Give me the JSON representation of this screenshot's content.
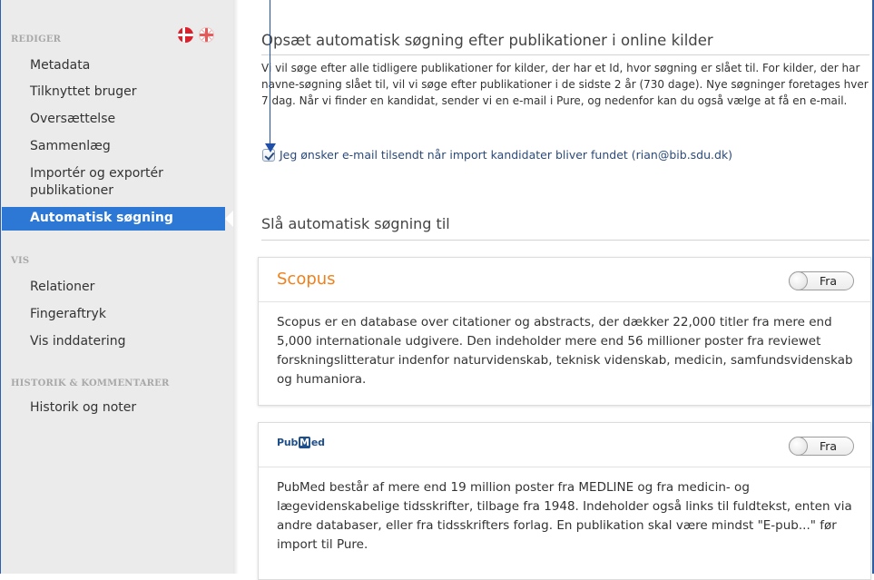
{
  "sidebar": {
    "section_edit": "REDIGER",
    "edit_items": [
      {
        "label": "Metadata"
      },
      {
        "label": "Tilknyttet bruger"
      },
      {
        "label": "Oversættelse"
      },
      {
        "label": "Sammenlæg"
      },
      {
        "label": "Importér og exportér publikationer"
      },
      {
        "label": "Automatisk søgning",
        "active": true
      }
    ],
    "section_view": "VIS",
    "view_items": [
      {
        "label": "Relationer"
      },
      {
        "label": "Fingeraftryk"
      },
      {
        "label": "Vis inddatering"
      }
    ],
    "section_history": "HISTORIK & KOMMENTARER",
    "history_items": [
      {
        "label": "Historik og noter"
      }
    ],
    "flags": [
      "danish-flag-icon",
      "uk-flag-icon"
    ]
  },
  "main": {
    "title": "Opsæt automatisk søgning efter publikationer i online kilder",
    "description": "Vi vil søge efter alle tidligere publikationer for kilder, der har et Id, hvor søgning er slået til. For kilder, der har navne-søgning slået til, vil vi søge efter publikationer i de sidste 2 år (730 dage). Nye søgninger foretages hver 7 dag. Når vi finder en kandidat, sender vi en e-mail i Pure, og nedenfor kan du også vælge at få en e-mail.",
    "email_checkbox": {
      "label": "Jeg ønsker e-mail tilsendt når import kandidater bliver fundet (rian@bib.sdu.dk)",
      "checked": true
    },
    "subtitle": "Slå automatisk søgning til",
    "sources": [
      {
        "name": "Scopus",
        "toggle_label": "Fra",
        "description": "Scopus er en database over citationer og abstracts, der dækker 22,000 titler fra mere end 5,000 internationale udgivere. Den indeholder mere end 56 millioner poster fra reviewet forskningslitteratur indenfor naturvidenskab, teknisk videnskab, medicin, samfundsvidenskab og humaniora."
      },
      {
        "name": "PubMed",
        "logo_left": "Pub",
        "logo_mid": "M",
        "logo_right": "ed",
        "toggle_label": "Fra",
        "description": "PubMed består af mere end 19 million poster fra MEDLINE og fra medicin- og lægevidenskabelige tidsskrifter, tilbage fra 1948. Indeholder også links til fuldtekst, enten via andre databaser, eller fra tidsskrifters forlag. En publikation skal være mindst \"E-pub...\" før import til Pure."
      }
    ]
  },
  "colors": {
    "accent": "#2c78d4",
    "scopus_orange": "#f0801c",
    "annotation_blue": "#1f4fa8"
  }
}
